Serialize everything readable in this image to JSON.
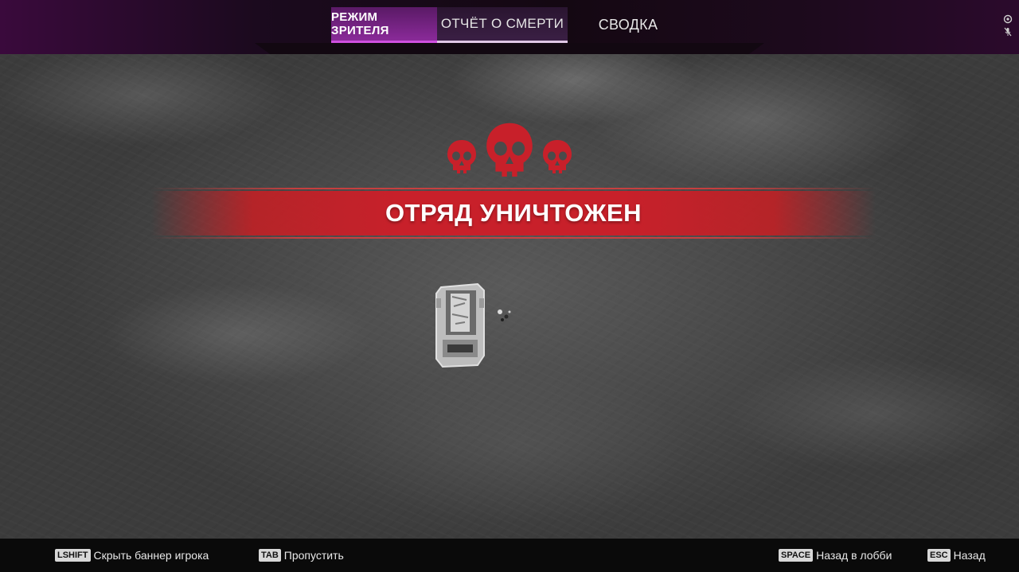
{
  "tabs": [
    {
      "label": "РЕЖИМ ЗРИТЕЛЯ",
      "state": "active"
    },
    {
      "label": "ОТЧЁТ О СМЕРТИ",
      "state": "highlighted"
    },
    {
      "label": "СВОДКА",
      "state": "normal"
    }
  ],
  "corner_icons": [
    "record-icon",
    "mic-muted-icon"
  ],
  "banner": {
    "text": "ОТРЯД УНИЧТОЖЕН",
    "skull_count": 3,
    "color": "#c8202a"
  },
  "hints": [
    {
      "key": "LSHIFT",
      "label": "Скрыть баннер игрока"
    },
    {
      "key": "TAB",
      "label": "Пропустить"
    },
    {
      "key": "SPACE",
      "label": "Назад в лобби"
    },
    {
      "key": "ESC",
      "label": "Назад"
    }
  ],
  "colors": {
    "accent_purple": "#8a2a99",
    "banner_red": "#c8202a",
    "skull_red": "#c8202a",
    "bottom_bar": "#0a0a0a"
  }
}
